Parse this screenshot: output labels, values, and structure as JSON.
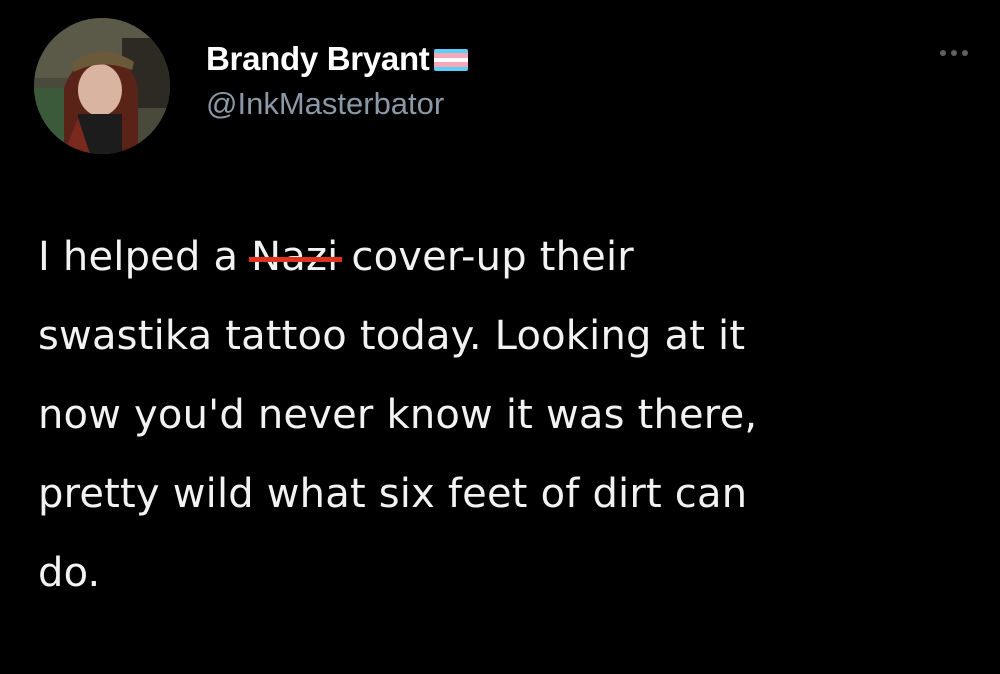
{
  "tweet": {
    "display_name": "Brandy Bryant",
    "handle": "@InkMasterbator",
    "flag_icon": "transgender-flag-icon",
    "flag_colors": [
      "#5BCEFA",
      "#F5A9B8",
      "#FFFFFF",
      "#F5A9B8",
      "#5BCEFA"
    ],
    "more_icon": "more-options-icon",
    "strike_color": "#E0321F",
    "body": {
      "line1_before": "I helped a ",
      "line1_struck": "Nazi",
      "line1_after": " cover-up their",
      "line2": "swastika tattoo today. Looking at it",
      "line3": "now you'd never know it was there,",
      "line4": "pretty wild what six feet of dirt can",
      "line5": "do."
    }
  }
}
